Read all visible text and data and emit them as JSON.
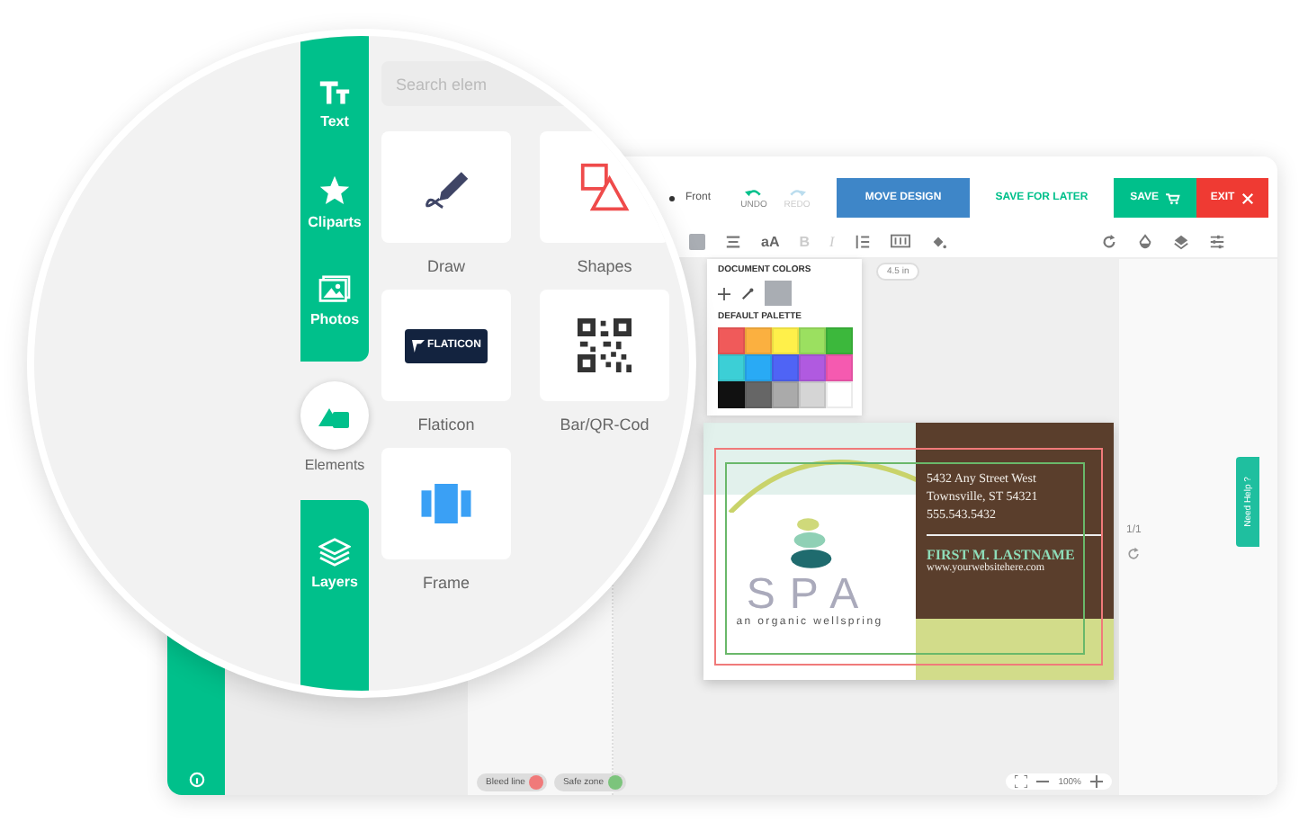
{
  "editor": {
    "header": {
      "page": "Front",
      "undo": {
        "label": "UNDO",
        "disabled": false
      },
      "redo": {
        "label": "REDO",
        "disabled": true
      },
      "buttons": [
        {
          "label": "MOVE DESIGN",
          "kind": "move"
        },
        {
          "label": "SAVE FOR LATER",
          "kind": "later"
        },
        {
          "label": "SAVE",
          "kind": "save"
        },
        {
          "label": "EXIT",
          "kind": "exit"
        }
      ]
    },
    "toolbar_text": [
      {
        "label": "aA",
        "disabled": false
      },
      {
        "label": "B",
        "disabled": true
      },
      {
        "label": "I",
        "disabled": true
      }
    ],
    "color_popup": {
      "document_title": "DOCUMENT COLORS",
      "document_colors": [
        {
          "color": "#a9adb3"
        }
      ],
      "palette_title": "DEFAULT PALETTE",
      "palette": [
        {
          "color": "#f05a5a"
        },
        {
          "color": "#fbb040"
        },
        {
          "color": "#fff04a"
        },
        {
          "color": "#9be060"
        },
        {
          "color": "#3cb83c"
        },
        {
          "color": "#3ccfd6"
        },
        {
          "color": "#29aaf5"
        },
        {
          "color": "#4f64f5"
        },
        {
          "color": "#b05ae0"
        },
        {
          "color": "#f55ab0"
        },
        {
          "color": "#111111"
        },
        {
          "color": "#666666"
        },
        {
          "color": "#aaaaaa"
        },
        {
          "color": "#d5d5d5"
        },
        {
          "color": "#ffffff"
        }
      ]
    },
    "ruler_label": "4.5 in",
    "card": {
      "address_lines": [
        "5432 Any Street West",
        "Townsville, ST 54321",
        "555.543.5432"
      ],
      "name": "FIRST M. LASTNAME",
      "website": "www.yourwebsitehere.com",
      "logo_text": "SPA",
      "tagline": "an organic wellspring"
    },
    "page_count": "1/1",
    "help_tab": "Need Help ?",
    "zoom": "100%",
    "chips": [
      {
        "label": "Bleed line",
        "color": "#f07a7a"
      },
      {
        "label": "Safe zone",
        "color": "#7cc47c"
      }
    ]
  },
  "magnifier": {
    "nav": [
      {
        "label": "Text",
        "selected": false
      },
      {
        "label": "Cliparts",
        "selected": false
      },
      {
        "label": "Photos",
        "selected": false
      },
      {
        "label": "Elements",
        "selected": true
      },
      {
        "label": "Layers",
        "selected": false
      }
    ],
    "search": {
      "placeholder": "Search elem"
    },
    "tiles": [
      {
        "label": "Draw",
        "kind": "draw"
      },
      {
        "label": "Shapes",
        "kind": "shapes"
      },
      {
        "label": "Flaticon",
        "kind": "flaticon",
        "logo_text": "FLATICON"
      },
      {
        "label": "Bar/QR-Cod",
        "kind": "qr"
      },
      {
        "label": "Frame",
        "kind": "frame"
      }
    ]
  }
}
